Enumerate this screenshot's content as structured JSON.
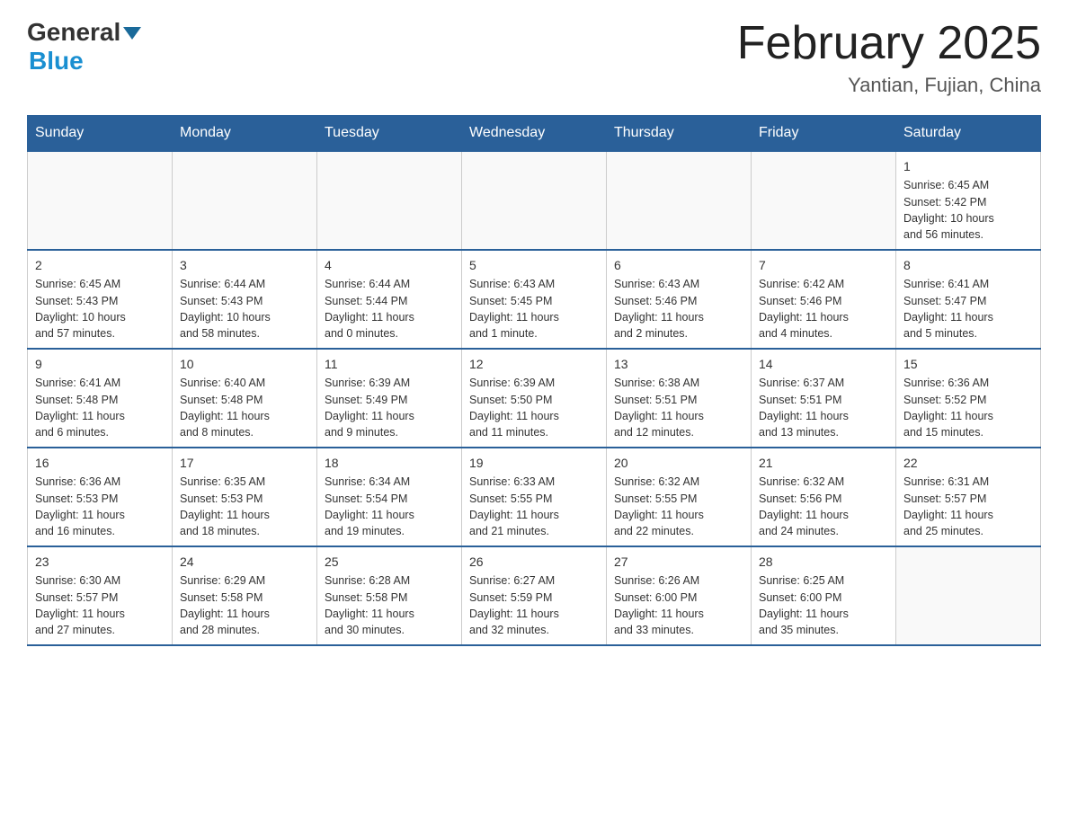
{
  "header": {
    "logo": {
      "general": "General",
      "blue": "Blue"
    },
    "month_title": "February 2025",
    "location": "Yantian, Fujian, China"
  },
  "days_of_week": [
    "Sunday",
    "Monday",
    "Tuesday",
    "Wednesday",
    "Thursday",
    "Friday",
    "Saturday"
  ],
  "weeks": [
    {
      "days": [
        {
          "date": "",
          "info": ""
        },
        {
          "date": "",
          "info": ""
        },
        {
          "date": "",
          "info": ""
        },
        {
          "date": "",
          "info": ""
        },
        {
          "date": "",
          "info": ""
        },
        {
          "date": "",
          "info": ""
        },
        {
          "date": "1",
          "info": "Sunrise: 6:45 AM\nSunset: 5:42 PM\nDaylight: 10 hours\nand 56 minutes."
        }
      ]
    },
    {
      "days": [
        {
          "date": "2",
          "info": "Sunrise: 6:45 AM\nSunset: 5:43 PM\nDaylight: 10 hours\nand 57 minutes."
        },
        {
          "date": "3",
          "info": "Sunrise: 6:44 AM\nSunset: 5:43 PM\nDaylight: 10 hours\nand 58 minutes."
        },
        {
          "date": "4",
          "info": "Sunrise: 6:44 AM\nSunset: 5:44 PM\nDaylight: 11 hours\nand 0 minutes."
        },
        {
          "date": "5",
          "info": "Sunrise: 6:43 AM\nSunset: 5:45 PM\nDaylight: 11 hours\nand 1 minute."
        },
        {
          "date": "6",
          "info": "Sunrise: 6:43 AM\nSunset: 5:46 PM\nDaylight: 11 hours\nand 2 minutes."
        },
        {
          "date": "7",
          "info": "Sunrise: 6:42 AM\nSunset: 5:46 PM\nDaylight: 11 hours\nand 4 minutes."
        },
        {
          "date": "8",
          "info": "Sunrise: 6:41 AM\nSunset: 5:47 PM\nDaylight: 11 hours\nand 5 minutes."
        }
      ]
    },
    {
      "days": [
        {
          "date": "9",
          "info": "Sunrise: 6:41 AM\nSunset: 5:48 PM\nDaylight: 11 hours\nand 6 minutes."
        },
        {
          "date": "10",
          "info": "Sunrise: 6:40 AM\nSunset: 5:48 PM\nDaylight: 11 hours\nand 8 minutes."
        },
        {
          "date": "11",
          "info": "Sunrise: 6:39 AM\nSunset: 5:49 PM\nDaylight: 11 hours\nand 9 minutes."
        },
        {
          "date": "12",
          "info": "Sunrise: 6:39 AM\nSunset: 5:50 PM\nDaylight: 11 hours\nand 11 minutes."
        },
        {
          "date": "13",
          "info": "Sunrise: 6:38 AM\nSunset: 5:51 PM\nDaylight: 11 hours\nand 12 minutes."
        },
        {
          "date": "14",
          "info": "Sunrise: 6:37 AM\nSunset: 5:51 PM\nDaylight: 11 hours\nand 13 minutes."
        },
        {
          "date": "15",
          "info": "Sunrise: 6:36 AM\nSunset: 5:52 PM\nDaylight: 11 hours\nand 15 minutes."
        }
      ]
    },
    {
      "days": [
        {
          "date": "16",
          "info": "Sunrise: 6:36 AM\nSunset: 5:53 PM\nDaylight: 11 hours\nand 16 minutes."
        },
        {
          "date": "17",
          "info": "Sunrise: 6:35 AM\nSunset: 5:53 PM\nDaylight: 11 hours\nand 18 minutes."
        },
        {
          "date": "18",
          "info": "Sunrise: 6:34 AM\nSunset: 5:54 PM\nDaylight: 11 hours\nand 19 minutes."
        },
        {
          "date": "19",
          "info": "Sunrise: 6:33 AM\nSunset: 5:55 PM\nDaylight: 11 hours\nand 21 minutes."
        },
        {
          "date": "20",
          "info": "Sunrise: 6:32 AM\nSunset: 5:55 PM\nDaylight: 11 hours\nand 22 minutes."
        },
        {
          "date": "21",
          "info": "Sunrise: 6:32 AM\nSunset: 5:56 PM\nDaylight: 11 hours\nand 24 minutes."
        },
        {
          "date": "22",
          "info": "Sunrise: 6:31 AM\nSunset: 5:57 PM\nDaylight: 11 hours\nand 25 minutes."
        }
      ]
    },
    {
      "days": [
        {
          "date": "23",
          "info": "Sunrise: 6:30 AM\nSunset: 5:57 PM\nDaylight: 11 hours\nand 27 minutes."
        },
        {
          "date": "24",
          "info": "Sunrise: 6:29 AM\nSunset: 5:58 PM\nDaylight: 11 hours\nand 28 minutes."
        },
        {
          "date": "25",
          "info": "Sunrise: 6:28 AM\nSunset: 5:58 PM\nDaylight: 11 hours\nand 30 minutes."
        },
        {
          "date": "26",
          "info": "Sunrise: 6:27 AM\nSunset: 5:59 PM\nDaylight: 11 hours\nand 32 minutes."
        },
        {
          "date": "27",
          "info": "Sunrise: 6:26 AM\nSunset: 6:00 PM\nDaylight: 11 hours\nand 33 minutes."
        },
        {
          "date": "28",
          "info": "Sunrise: 6:25 AM\nSunset: 6:00 PM\nDaylight: 11 hours\nand 35 minutes."
        },
        {
          "date": "",
          "info": ""
        }
      ]
    }
  ]
}
